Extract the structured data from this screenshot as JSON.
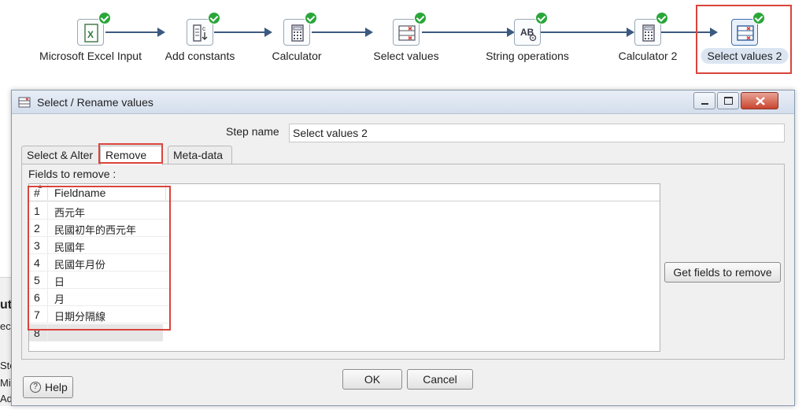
{
  "pipeline": {
    "steps": [
      {
        "label": "Microsoft Excel Input",
        "icon": "excel-icon",
        "status": "ok"
      },
      {
        "label": "Add constants",
        "icon": "add-constants-icon",
        "status": "ok"
      },
      {
        "label": "Calculator",
        "icon": "calculator-icon",
        "status": "ok"
      },
      {
        "label": "Select values",
        "icon": "select-values-icon",
        "status": "ok"
      },
      {
        "label": "String operations",
        "icon": "string-operations-icon",
        "status": "ok"
      },
      {
        "label": "Calculator 2",
        "icon": "calculator-icon",
        "status": "ok"
      },
      {
        "label": "Select values 2",
        "icon": "select-values-icon",
        "status": "ok",
        "selected": true
      }
    ]
  },
  "background_fragments": [
    "ut",
    "ec",
    "Ste",
    "Mi",
    "Ad"
  ],
  "dialog": {
    "title": "Select / Rename values",
    "step_name_label": "Step name",
    "step_name_value": "Select values 2",
    "tabs": [
      {
        "label": "Select & Alter",
        "active": false
      },
      {
        "label": "Remove",
        "active": true
      },
      {
        "label": "Meta-data",
        "active": false
      }
    ],
    "fields_to_remove_label": "Fields to remove :",
    "grid": {
      "headers": [
        "#",
        "Fieldname"
      ],
      "rows": [
        {
          "num": "1",
          "name": "西元年"
        },
        {
          "num": "2",
          "name": "民國初年的西元年"
        },
        {
          "num": "3",
          "name": "民國年"
        },
        {
          "num": "4",
          "name": "民國年月份"
        },
        {
          "num": "5",
          "name": "日"
        },
        {
          "num": "6",
          "name": "月"
        },
        {
          "num": "7",
          "name": "日期分隔線"
        },
        {
          "num": "8",
          "name": ""
        }
      ]
    },
    "get_fields_button": "Get fields to remove",
    "ok_button": "OK",
    "cancel_button": "Cancel",
    "help_button": "Help"
  },
  "colors": {
    "highlight": "#d9443c",
    "hop": "#3c5a80",
    "status_ok": "#2aa63a"
  }
}
